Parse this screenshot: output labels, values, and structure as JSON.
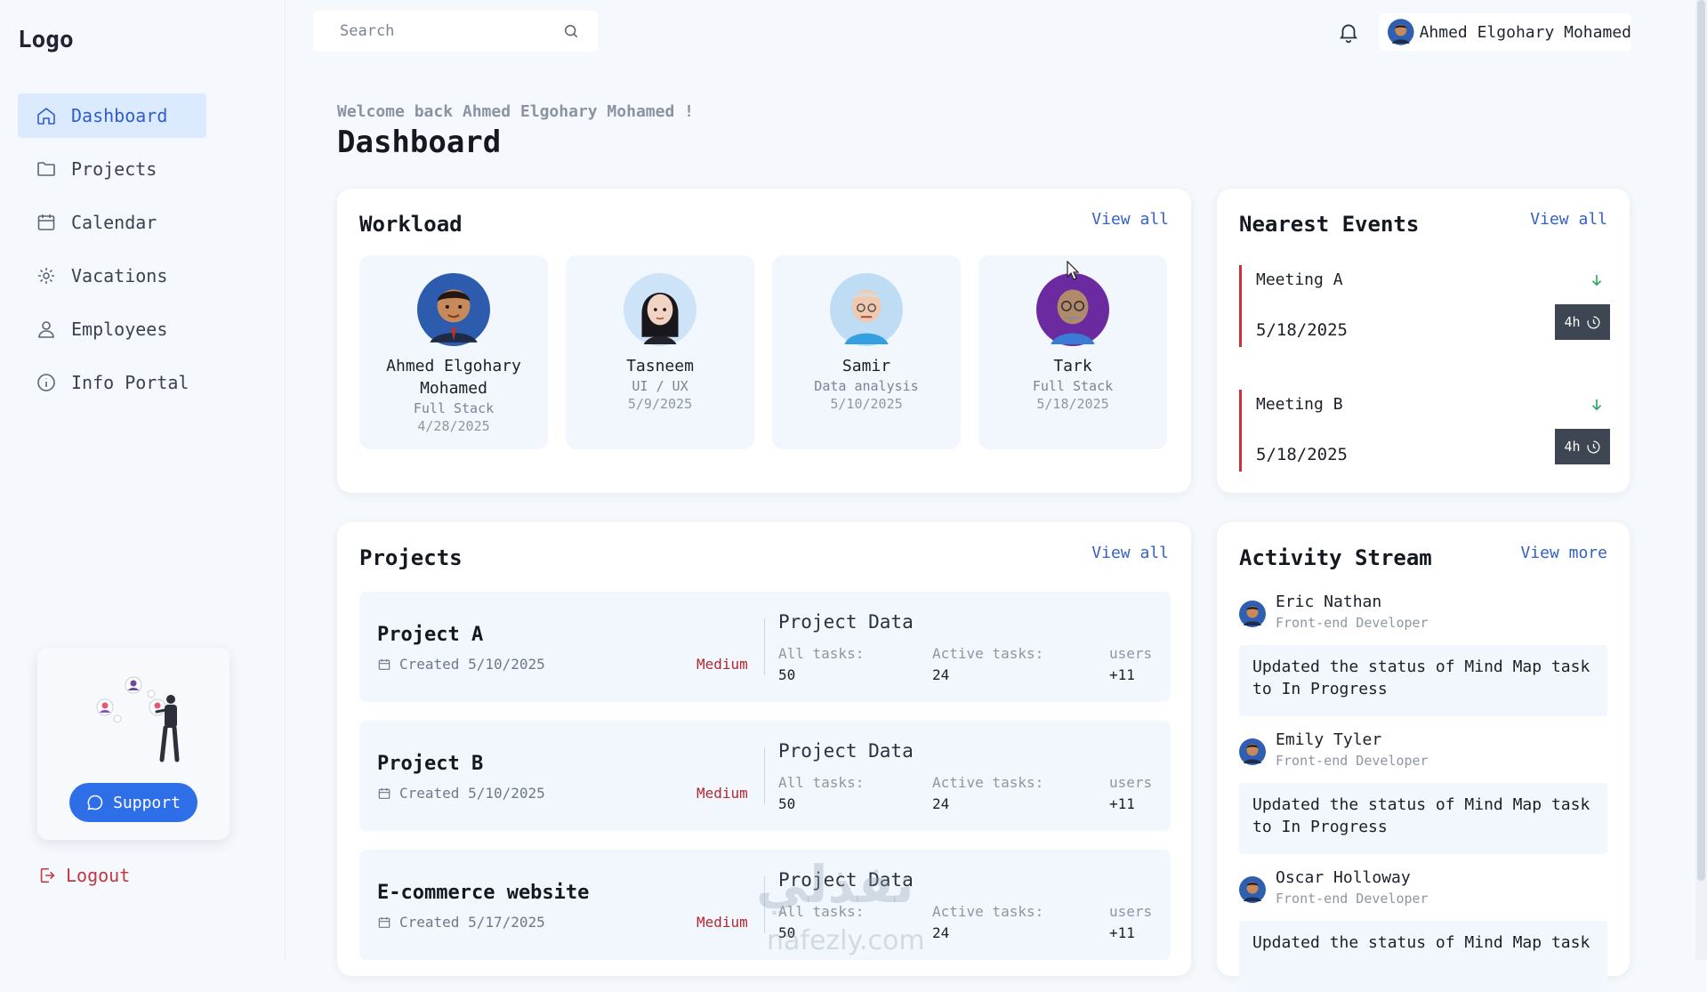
{
  "sidebar": {
    "logo": "Logo",
    "items": [
      {
        "label": "Dashboard",
        "icon": "home-icon",
        "active": true
      },
      {
        "label": "Projects",
        "icon": "folder-icon"
      },
      {
        "label": "Calendar",
        "icon": "calendar-icon"
      },
      {
        "label": "Vacations",
        "icon": "gear-icon"
      },
      {
        "label": "Employees",
        "icon": "user-icon"
      },
      {
        "label": "Info Portal",
        "icon": "info-icon"
      }
    ],
    "support_label": "Support",
    "logout_label": "Logout"
  },
  "header": {
    "search_placeholder": "Search",
    "user_name": "Ahmed Elgohary Mohamed"
  },
  "main": {
    "welcome": "Welcome back Ahmed Elgohary Mohamed !",
    "title": "Dashboard"
  },
  "workload": {
    "title": "Workload",
    "link": "View all",
    "members": [
      {
        "name": "Ahmed Elgohary Mohamed",
        "role": "Full Stack",
        "date": "4/28/2025"
      },
      {
        "name": "Tasneem",
        "role": "UI / UX",
        "date": "5/9/2025"
      },
      {
        "name": "Samir",
        "role": "Data analysis",
        "date": "5/10/2025"
      },
      {
        "name": "Tark",
        "role": "Full Stack",
        "date": "5/18/2025"
      }
    ]
  },
  "events": {
    "title": "Nearest Events",
    "link": "View all",
    "items": [
      {
        "name": "Meeting A",
        "date": "5/18/2025",
        "duration": "4h"
      },
      {
        "name": "Meeting B",
        "date": "5/18/2025",
        "duration": "4h"
      }
    ]
  },
  "projects": {
    "title": "Projects",
    "link": "View all",
    "data_title": "Project Data",
    "labels": {
      "all": "All tasks:",
      "active": "Active tasks:",
      "users": "users"
    },
    "items": [
      {
        "name": "Project A",
        "created": "Created 5/10/2025",
        "priority": "Medium",
        "all_tasks": "50",
        "active_tasks": "24",
        "users": "+11"
      },
      {
        "name": "Project B",
        "created": "Created 5/10/2025",
        "priority": "Medium",
        "all_tasks": "50",
        "active_tasks": "24",
        "users": "+11"
      },
      {
        "name": "E-commerce website",
        "created": "Created 5/17/2025",
        "priority": "Medium",
        "all_tasks": "50",
        "active_tasks": "24",
        "users": "+11"
      }
    ]
  },
  "activity": {
    "title": "Activity Stream",
    "link": "View more",
    "items": [
      {
        "name": "Eric Nathan",
        "role": "Front-end Developer",
        "message": "Updated the status of Mind Map task to In Progress"
      },
      {
        "name": "Emily Tyler",
        "role": "Front-end Developer",
        "message": "Updated the status of Mind Map task to In Progress"
      },
      {
        "name": "Oscar Holloway",
        "role": "Front-end Developer",
        "message": "Updated the status of Mind Map task"
      }
    ]
  },
  "watermark": {
    "arabic": "نفذلي",
    "latin": "nafezly.com"
  },
  "colors": {
    "accent": "#2e6fe8",
    "active_bg": "#dceaff",
    "priority": "#b0282f",
    "event_border": "#c8323e",
    "badge_bg": "#3e4654"
  }
}
